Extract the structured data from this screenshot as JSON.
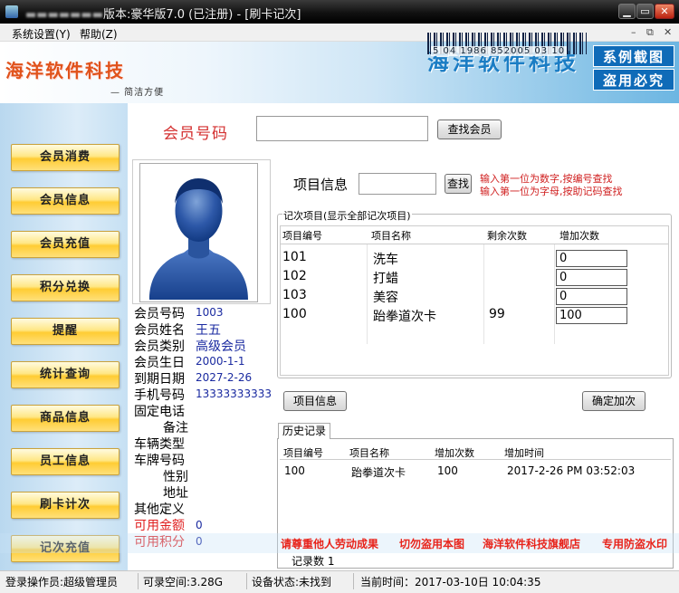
{
  "window": {
    "app_icon": "app-icon",
    "title_blurred": "▬▬▬▬▬▬▬",
    "title": "版本:豪华版7.0 (已注册) - [刷卡记次]",
    "min": "▁",
    "max": "▭",
    "close": "✕"
  },
  "menu": {
    "items": [
      "系统设置(Y)",
      "帮助(Z)"
    ],
    "mdi_controls": [
      "–",
      "⧉",
      "✕"
    ]
  },
  "banner": {
    "logo_left": "海洋软件科技",
    "slogan": "— 简洁方便",
    "logo_right": "海洋软件科技",
    "barcode_text": "5 04 1986 852005 03 10",
    "stamp_lines": [
      "系例截图",
      "盗用必究"
    ]
  },
  "nav": {
    "items": [
      "会员消费",
      "会员信息",
      "会员充值",
      "积分兑换",
      "提醒",
      "统计查询",
      "商品信息",
      "员工信息",
      "刷卡计次",
      "记次充值"
    ]
  },
  "search": {
    "card_label": "会员号码",
    "card_value": "",
    "find_button": "查找会员"
  },
  "member": {
    "fields": [
      {
        "label": "会员号码",
        "value": "1003"
      },
      {
        "label": "会员姓名",
        "value": "王五"
      },
      {
        "label": "会员类别",
        "value": "高级会员"
      },
      {
        "label": "会员生日",
        "value": "2000-1-1"
      },
      {
        "label": "到期日期",
        "value": "2027-2-26"
      },
      {
        "label": "手机号码",
        "value": "13333333333"
      },
      {
        "label": "固定电话",
        "value": ""
      },
      {
        "label": "备注",
        "value": ""
      },
      {
        "label": "车辆类型",
        "value": ""
      },
      {
        "label": "车牌号码",
        "value": ""
      },
      {
        "label": "性别",
        "value": ""
      },
      {
        "label": "地址",
        "value": ""
      },
      {
        "label": "其他定义",
        "value": ""
      },
      {
        "label": "可用金额",
        "value": "0"
      },
      {
        "label": "可用积分",
        "value": "0"
      }
    ]
  },
  "project": {
    "label": "项目信息",
    "input_value": "",
    "search_button": "查找",
    "hints": [
      "输入第一位为数字,按编号查找",
      "输入第一位为字母,按助记码查找"
    ]
  },
  "grid": {
    "title": "记次项目(显示全部记次项目)",
    "columns": [
      "项目编号",
      "项目名称",
      "剩余次数",
      "增加次数"
    ],
    "rows": [
      {
        "id": "101",
        "name": "洗车",
        "remaining": "",
        "add": "0"
      },
      {
        "id": "102",
        "name": "打蜡",
        "remaining": "",
        "add": "0"
      },
      {
        "id": "103",
        "name": "美容",
        "remaining": "",
        "add": "0"
      },
      {
        "id": "100",
        "name": "跆拳道次卡",
        "remaining": "99",
        "add": "100"
      }
    ]
  },
  "actions": {
    "project_info": "项目信息",
    "confirm_add": "确定加次"
  },
  "history": {
    "tab": "历史记录",
    "columns": [
      "项目编号",
      "项目名称",
      "增加次数",
      "增加时间"
    ],
    "rows": [
      {
        "id": "100",
        "name": "跆拳道次卡",
        "count": "100",
        "time": "2017-2-26 PM 03:52:03"
      }
    ],
    "record_count": "记录数 1"
  },
  "watermark": [
    "请尊重他人劳动成果",
    "切勿盗用本图",
    "海洋软件科技旗舰店",
    "专用防盗水印"
  ],
  "status": {
    "operator": "登录操作员:超级管理员",
    "space": "可录空间:3.28G",
    "device": "设备状态:未找到",
    "time": "当前时间：2017-03-10日 10:04:35"
  }
}
